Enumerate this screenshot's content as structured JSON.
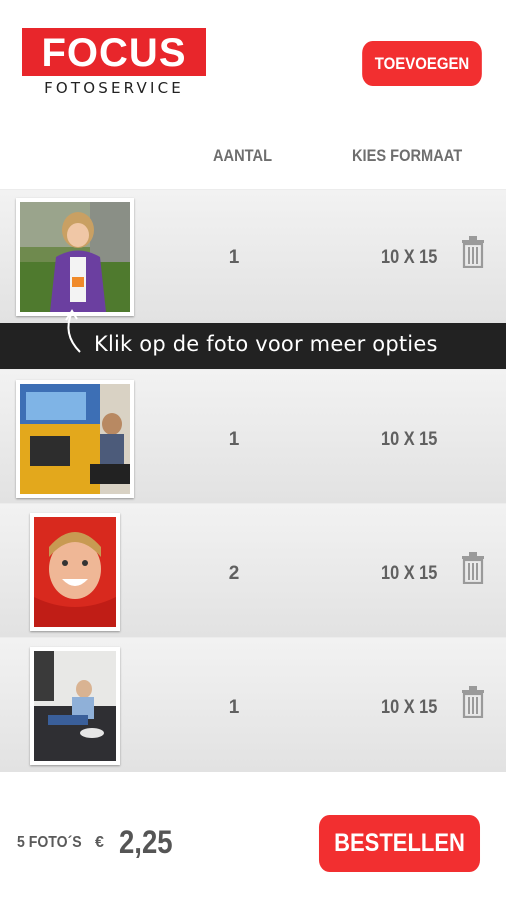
{
  "header": {
    "logo_main": "FOCUS",
    "logo_sub": "FOTOSERVICE",
    "add_button_label": "TOEVOEGEN"
  },
  "columns": {
    "quantity": "AANTAL",
    "format": "KIES FORMAAT"
  },
  "photos": [
    {
      "quantity": "1",
      "format": "10 X 15",
      "icon": "trash-icon"
    },
    {
      "quantity": "1",
      "format": "10 X 15",
      "icon": "trash-icon"
    },
    {
      "quantity": "2",
      "format": "10 X 15",
      "icon": "trash-icon"
    },
    {
      "quantity": "1",
      "format": "10 X 15",
      "icon": "trash-icon"
    }
  ],
  "tooltip": {
    "text": "Klik op de foto voor meer opties"
  },
  "footer": {
    "photo_count": "5 FOTO´S",
    "currency": "€",
    "total": "2,25",
    "order_button_label": "BESTELLEN"
  },
  "colors": {
    "accent": "#f22f30",
    "banner": "#222222"
  }
}
